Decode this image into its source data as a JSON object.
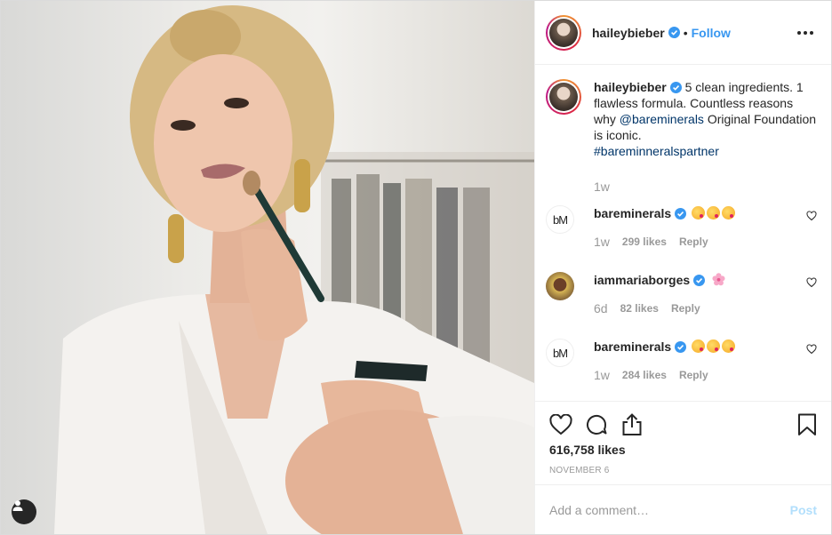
{
  "photo": {
    "alt": "Photo by haileybieber"
  },
  "header": {
    "username": "haileybieber",
    "separator": "•",
    "follow_label": "Follow"
  },
  "caption": {
    "username": "haileybieber",
    "text_1": "5 clean ingredients. 1 flawless formula. Countless reasons why ",
    "mention": "@bareminerals",
    "text_2": " Original Foundation is iconic.",
    "hashtag": "#bareminneralspartner",
    "time": "1w"
  },
  "comments": [
    {
      "username": "bareminerals",
      "avatar_text": "bM",
      "time": "1w",
      "likes": "299 likes",
      "reply": "Reply"
    },
    {
      "username": "iammariaborges",
      "time": "6d",
      "likes": "82 likes",
      "reply": "Reply"
    },
    {
      "username": "bareminerals",
      "avatar_text": "bM",
      "time": "1w",
      "likes": "284 likes",
      "reply": "Reply"
    }
  ],
  "likes_count": "616,758 likes",
  "date": "NOVEMBER 6",
  "add_comment": {
    "placeholder": "Add a comment…",
    "post_label": "Post"
  },
  "colors": {
    "link": "#003569",
    "follow": "#3897f0",
    "verified": "#3897f0",
    "post_disabled": "#b2dffc"
  }
}
